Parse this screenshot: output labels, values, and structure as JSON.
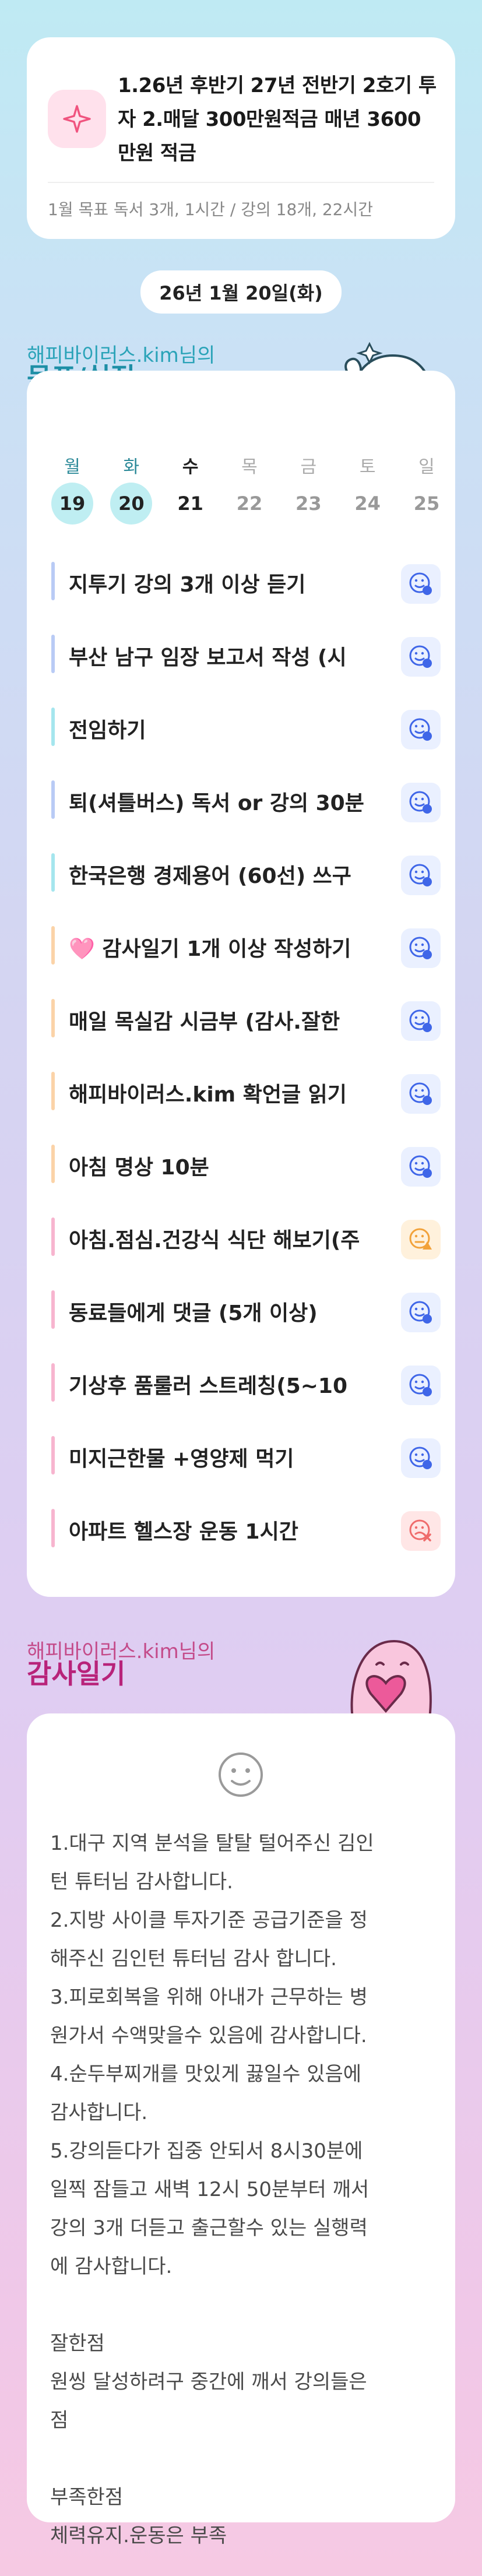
{
  "goal": {
    "icon": "sparkle-icon",
    "title": "1.26년 후반기 27년 전반기 2호기 투자 2.매달 300만원적금 매년 3600만원 적금",
    "subtitle": "1월 목표  독서 3개, 1시간 / 강의 18개, 22시간"
  },
  "date": "26년 1월 20일(화)",
  "tasks_section": {
    "user": "해피바이러스.kim님의",
    "title": "목표/실적"
  },
  "week": [
    {
      "day": "월",
      "date": "19",
      "state": "done"
    },
    {
      "day": "화",
      "date": "20",
      "state": "done"
    },
    {
      "day": "수",
      "date": "21",
      "state": "today"
    },
    {
      "day": "목",
      "date": "22",
      "state": "future"
    },
    {
      "day": "금",
      "date": "23",
      "state": "future"
    },
    {
      "day": "토",
      "date": "24",
      "state": "future"
    },
    {
      "day": "일",
      "date": "25",
      "state": "future"
    }
  ],
  "tasks": [
    {
      "label": "지투기 강의 3개 이상 듣기",
      "bar": "#b9cbf5",
      "status": "pending"
    },
    {
      "label": "부산 남구 임장 보고서 작성 (시",
      "bar": "#b9cbf5",
      "status": "pending"
    },
    {
      "label": "전임하기",
      "bar": "#a5e6ee",
      "status": "pending"
    },
    {
      "label": "퇴(셔틀버스) 독서 or 강의 30분",
      "bar": "#b9cbf5",
      "status": "pending"
    },
    {
      "label": "한국은행 경제용어 (60선) 쓰구",
      "bar": "#a5e6ee",
      "status": "pending"
    },
    {
      "label": "🩷 감사일기 1개 이상 작성하기",
      "bar": "#fbd3a8",
      "status": "pending"
    },
    {
      "label": "매일 목실감 시금부 (감사.잘한",
      "bar": "#fbd3a8",
      "status": "pending"
    },
    {
      "label": "해피바이러스.kim 확언글 읽기",
      "bar": "#fbd3a8",
      "status": "pending"
    },
    {
      "label": "아침 명상 10분",
      "bar": "#fbd3a8",
      "status": "pending"
    },
    {
      "label": "아침.점심.건강식 식단 해보기(주",
      "bar": "#f7b5cf",
      "status": "warning"
    },
    {
      "label": "동료들에게 댓글 (5개 이상)",
      "bar": "#f7b5cf",
      "status": "pending"
    },
    {
      "label": "기상후 품룰러 스트레칭(5~10",
      "bar": "#f7b5cf",
      "status": "pending"
    },
    {
      "label": "미지근한물 +영양제 먹기",
      "bar": "#f7b5cf",
      "status": "pending"
    },
    {
      "label": "아파트 헬스장 운동 1시간",
      "bar": "#f7b5cf",
      "status": "failed"
    }
  ],
  "gratitude_section": {
    "user": "해피바이러스.kim님의",
    "title": "감사일기"
  },
  "gratitude": {
    "icon": "smile-icon",
    "lines": [
      "1.대구 지역 분석을 탈탈 털어주신  김인",
      "턴 튜터님 감사합니다.",
      "2.지방 사이클 투자기준 공급기준을 정",
      "해주신 김인턴 튜터님 감사 합니다.",
      "3.피로회복을 위해 아내가 근무하는 병",
      "원가서 수액맞을수 있음에 감사합니다.",
      "4.순두부찌개를 맛있게 끓일수 있음에",
      "감사합니다.",
      "5.강의듣다가 집중 안되서 8시30분에",
      "일찍 잠들고 새벽 12시 50분부터 깨서",
      "강의 3개  더듣고 출근할수 있는 실행력",
      "에 감사합니다.",
      "",
      "잘한점",
      "원씽 달성하려구 중간에 깨서 강의들은",
      "점",
      "",
      "부족한점",
      "체력유지.운동은 부족"
    ]
  },
  "colors": {
    "accent_teal": "#2aa3b8",
    "check_blue": "#3f66e8",
    "warning_orange": "#f2a23a",
    "fail_red": "#ef6b6b"
  }
}
